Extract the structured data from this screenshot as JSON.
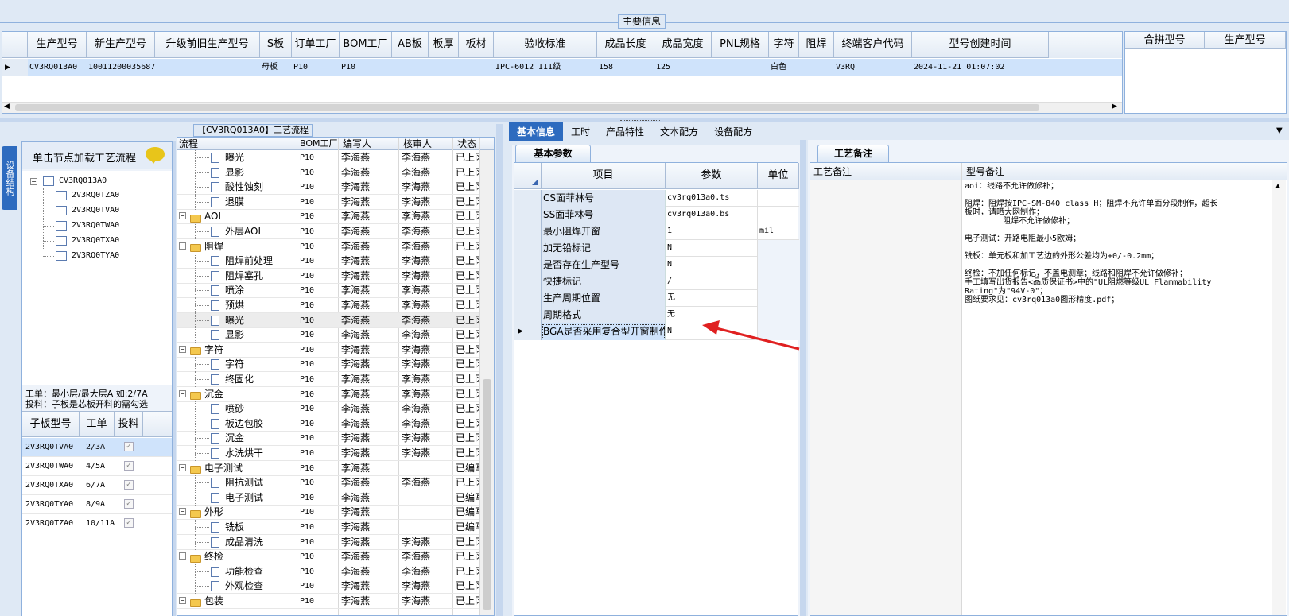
{
  "main_info": {
    "legend": "主要信息",
    "columns": [
      "生产型号",
      "新生产型号",
      "升级前旧生产型号",
      "S板",
      "订单工厂",
      "BOM工厂",
      "AB板",
      "板厚",
      "板材",
      "验收标准",
      "成品长度",
      "成品宽度",
      "PNL规格",
      "字符",
      "阻焊",
      "终端客户代码",
      "型号创建时间"
    ],
    "row": [
      "CV3RQ013A0",
      "10011200035687",
      "",
      "母板",
      "P10",
      "P10",
      "",
      "",
      "",
      "IPC-6012 III级",
      "158",
      "125",
      "",
      "白色",
      "",
      "V3RQ",
      "2024-11-21 01:07:02"
    ],
    "side_columns": [
      "合拼型号",
      "生产型号"
    ]
  },
  "process": {
    "legend": "【CV3RQ013A0】工艺流程",
    "vertical_tab": "设备结构",
    "load_hint": "单击节点加载工艺流程",
    "root": "CV3RQ013A0",
    "children": [
      "2V3RQ0TZA0",
      "2V3RQ0TVA0",
      "2V3RQ0TWA0",
      "2V3RQ0TXA0",
      "2V3RQ0TYA0"
    ],
    "note_line1": "工单：最小层/最大层A 如:2/7A",
    "note_line2": "投料：子板是芯板开料的需勾选",
    "sub_headers": [
      "子板型号",
      "工单",
      "投料"
    ],
    "sub_rows": [
      {
        "model": "2V3RQ0TVA0",
        "order": "2/3A",
        "check": "✓"
      },
      {
        "model": "2V3RQ0TWA0",
        "order": "4/5A",
        "check": "✓"
      },
      {
        "model": "2V3RQ0TXA0",
        "order": "6/7A",
        "check": "✓"
      },
      {
        "model": "2V3RQ0TYA0",
        "order": "8/9A",
        "check": "✓"
      },
      {
        "model": "2V3RQ0TZA0",
        "order": "10/11A",
        "check": "✓"
      }
    ],
    "flow_headers": [
      "流程",
      "BOM工厂",
      "编写人",
      "核审人",
      "状态"
    ],
    "flow_rows": [
      {
        "name": "曝光",
        "level": 2,
        "type": "doc",
        "bom": "P10",
        "writer": "李海燕",
        "reviewer": "李海燕",
        "status": "已上冈"
      },
      {
        "name": "显影",
        "level": 2,
        "type": "doc",
        "bom": "P10",
        "writer": "李海燕",
        "reviewer": "李海燕",
        "status": "已上冈"
      },
      {
        "name": "酸性蚀刻",
        "level": 2,
        "type": "doc",
        "bom": "P10",
        "writer": "李海燕",
        "reviewer": "李海燕",
        "status": "已上冈"
      },
      {
        "name": "退膜",
        "level": 2,
        "type": "doc",
        "bom": "P10",
        "writer": "李海燕",
        "reviewer": "李海燕",
        "status": "已上冈"
      },
      {
        "name": "AOI",
        "level": 1,
        "type": "folder",
        "bom": "P10",
        "writer": "李海燕",
        "reviewer": "李海燕",
        "status": "已上冈"
      },
      {
        "name": "外层AOI",
        "level": 2,
        "type": "doc",
        "bom": "P10",
        "writer": "李海燕",
        "reviewer": "李海燕",
        "status": "已上冈"
      },
      {
        "name": "阻焊",
        "level": 1,
        "type": "folder",
        "bom": "P10",
        "writer": "李海燕",
        "reviewer": "李海燕",
        "status": "已上冈"
      },
      {
        "name": "阻焊前处理",
        "level": 2,
        "type": "doc",
        "bom": "P10",
        "writer": "李海燕",
        "reviewer": "李海燕",
        "status": "已上冈"
      },
      {
        "name": "阻焊塞孔",
        "level": 2,
        "type": "doc",
        "bom": "P10",
        "writer": "李海燕",
        "reviewer": "李海燕",
        "status": "已上冈"
      },
      {
        "name": "喷涂",
        "level": 2,
        "type": "doc",
        "bom": "P10",
        "writer": "李海燕",
        "reviewer": "李海燕",
        "status": "已上冈"
      },
      {
        "name": "预烘",
        "level": 2,
        "type": "doc",
        "bom": "P10",
        "writer": "李海燕",
        "reviewer": "李海燕",
        "status": "已上冈"
      },
      {
        "name": "曝光",
        "level": 2,
        "type": "doc",
        "bom": "P10",
        "writer": "李海燕",
        "reviewer": "李海燕",
        "status": "已上冈",
        "selected": true
      },
      {
        "name": "显影",
        "level": 2,
        "type": "doc",
        "bom": "P10",
        "writer": "李海燕",
        "reviewer": "李海燕",
        "status": "已上冈"
      },
      {
        "name": "字符",
        "level": 1,
        "type": "folder",
        "bom": "P10",
        "writer": "李海燕",
        "reviewer": "李海燕",
        "status": "已上冈"
      },
      {
        "name": "字符",
        "level": 2,
        "type": "doc",
        "bom": "P10",
        "writer": "李海燕",
        "reviewer": "李海燕",
        "status": "已上冈"
      },
      {
        "name": "终固化",
        "level": 2,
        "type": "doc",
        "bom": "P10",
        "writer": "李海燕",
        "reviewer": "李海燕",
        "status": "已上冈"
      },
      {
        "name": "沉金",
        "level": 1,
        "type": "folder",
        "bom": "P10",
        "writer": "李海燕",
        "reviewer": "李海燕",
        "status": "已上冈"
      },
      {
        "name": "喷砂",
        "level": 2,
        "type": "doc",
        "bom": "P10",
        "writer": "李海燕",
        "reviewer": "李海燕",
        "status": "已上冈"
      },
      {
        "name": "板边包胶",
        "level": 2,
        "type": "doc",
        "bom": "P10",
        "writer": "李海燕",
        "reviewer": "李海燕",
        "status": "已上冈"
      },
      {
        "name": "沉金",
        "level": 2,
        "type": "doc",
        "bom": "P10",
        "writer": "李海燕",
        "reviewer": "李海燕",
        "status": "已上冈"
      },
      {
        "name": "水洗烘干",
        "level": 2,
        "type": "doc",
        "bom": "P10",
        "writer": "李海燕",
        "reviewer": "李海燕",
        "status": "已上冈"
      },
      {
        "name": "电子测试",
        "level": 1,
        "type": "folder",
        "bom": "P10",
        "writer": "李海燕",
        "reviewer": "",
        "status": "已编写"
      },
      {
        "name": "阻抗测试",
        "level": 2,
        "type": "doc",
        "bom": "P10",
        "writer": "李海燕",
        "reviewer": "李海燕",
        "status": "已上冈"
      },
      {
        "name": "电子测试",
        "level": 2,
        "type": "doc",
        "bom": "P10",
        "writer": "李海燕",
        "reviewer": "",
        "status": "已编写"
      },
      {
        "name": "外形",
        "level": 1,
        "type": "folder",
        "bom": "P10",
        "writer": "李海燕",
        "reviewer": "",
        "status": "已编写"
      },
      {
        "name": "铣板",
        "level": 2,
        "type": "doc",
        "bom": "P10",
        "writer": "李海燕",
        "reviewer": "",
        "status": "已编写"
      },
      {
        "name": "成品清洗",
        "level": 2,
        "type": "doc",
        "bom": "P10",
        "writer": "李海燕",
        "reviewer": "李海燕",
        "status": "已上冈"
      },
      {
        "name": "终检",
        "level": 1,
        "type": "folder",
        "bom": "P10",
        "writer": "李海燕",
        "reviewer": "李海燕",
        "status": "已上冈"
      },
      {
        "name": "功能检查",
        "level": 2,
        "type": "doc",
        "bom": "P10",
        "writer": "李海燕",
        "reviewer": "李海燕",
        "status": "已上冈"
      },
      {
        "name": "外观检查",
        "level": 2,
        "type": "doc",
        "bom": "P10",
        "writer": "李海燕",
        "reviewer": "李海燕",
        "status": "已上冈"
      },
      {
        "name": "包装",
        "level": 1,
        "type": "folder",
        "bom": "P10",
        "writer": "李海燕",
        "reviewer": "李海燕",
        "status": "已上冈"
      }
    ]
  },
  "tabs": [
    "基本信息",
    "工时",
    "产品特性",
    "文本配方",
    "设备配方"
  ],
  "basic_params": {
    "tab": "基本参数",
    "headers": [
      "项目",
      "参数",
      "单位"
    ],
    "rows": [
      {
        "item": "CS面菲林号",
        "value": "cv3rq013a0.ts",
        "unit": ""
      },
      {
        "item": "SS面菲林号",
        "value": "cv3rq013a0.bs",
        "unit": ""
      },
      {
        "item": "最小阻焊开窗",
        "value": "1",
        "unit": "mil"
      },
      {
        "item": "加无铅标记",
        "value": "N",
        "unit": ""
      },
      {
        "item": "是否存在生产型号",
        "value": "N",
        "unit": ""
      },
      {
        "item": "快捷标记",
        "value": "/",
        "unit": ""
      },
      {
        "item": "生产周期位置",
        "value": "无",
        "unit": ""
      },
      {
        "item": "周期格式",
        "value": "无",
        "unit": ""
      },
      {
        "item": "BGA是否采用复合型开窗制作",
        "value": "N",
        "unit": "",
        "selected": true
      }
    ]
  },
  "remarks": {
    "tab": "工艺备注",
    "col1": "工艺备注",
    "col2": "型号备注",
    "lines": [
      "aoi：线路不允许做修补；",
      "",
      "阻焊：阻焊按IPC-SM-840 class H；阻焊不允许单面分段制作，超长",
      "板时，请晒大网制作；",
      "        阻焊不允许做修补；",
      "",
      "电子测试：开路电阻最小5欧姆；",
      "",
      "铣板：单元板和加工艺边的外形公差均为+0/-0.2mm；",
      "",
      "终检：不加任何标记，不盖电测章；线路和阻焊不允许做修补；",
      "手工填写出货报告<品质保证书>中的\"UL阻燃等级UL Flammability",
      "Rating\"为\"94V-0\"；",
      "图纸要求见：cv3rq013a0图形精度.pdf；"
    ]
  },
  "colors": {
    "accent": "#2d6bbf",
    "selected_row": "#cfe3fb",
    "arrow": "#e02020"
  }
}
